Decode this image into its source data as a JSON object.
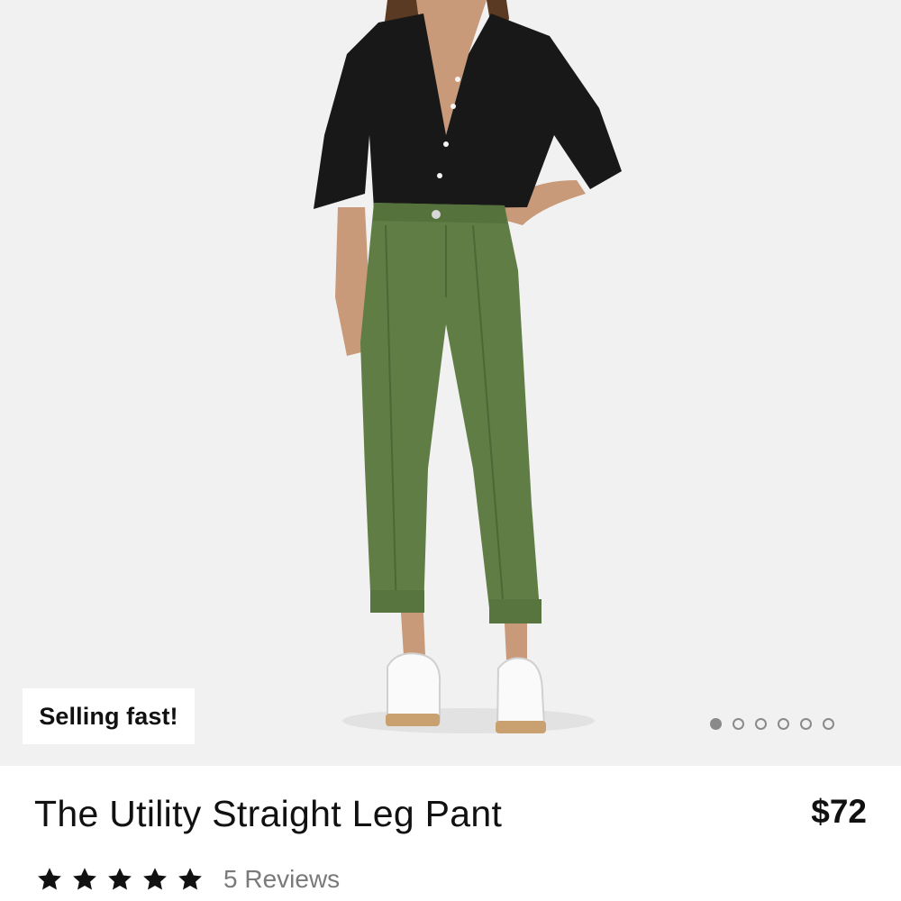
{
  "product": {
    "badge": "Selling fast!",
    "title": "The Utility Straight Leg Pant",
    "price": "$72",
    "rating": {
      "stars": 5,
      "max": 5,
      "reviews_label": "5 Reviews"
    }
  },
  "carousel": {
    "total": 6,
    "active_index": 0
  },
  "colors": {
    "image_bg": "#f1f1f1",
    "text": "#111111",
    "muted": "#7a7a7a",
    "pant_green": "#5f7d45",
    "shirt_black": "#181818"
  },
  "icons": {
    "star": "star-icon",
    "carousel_dot": "carousel-dot-icon"
  }
}
